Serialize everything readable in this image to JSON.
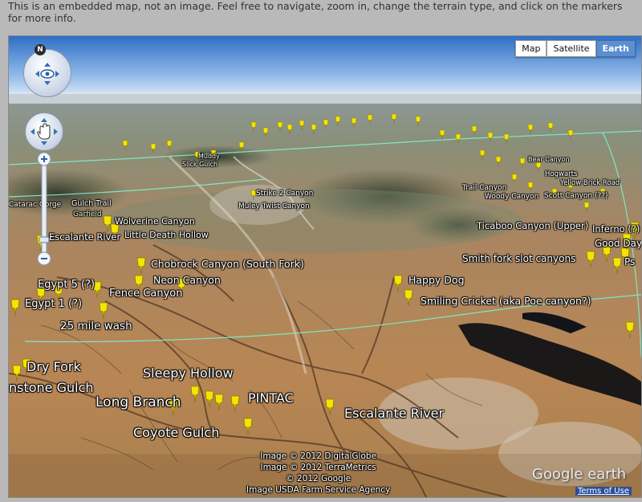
{
  "intro_text": "This is an embedded map, not an image. Feel free to navigate, zoom in, change the terrain type, and click on the markers for more info.",
  "view_buttons": [
    "Map",
    "Satellite",
    "Earth"
  ],
  "active_view": "Earth",
  "compass_letter": "N",
  "icons": {
    "look": "eye-icon",
    "pan": "hand-icon",
    "zoom_in": "plus-icon",
    "zoom_out": "minus-icon",
    "marker": "yellow-pushpin-icon"
  },
  "colors": {
    "marker": "#f5e400",
    "boundary_line": "#7fe7c4",
    "active_button": "#5b8fd0"
  },
  "labels": {
    "l01": "Catarac Gorge",
    "l02": "Gulch Trail",
    "l03": "Garfield",
    "l04": "Wolverine Canyon",
    "l05": "Escalante River",
    "l06": "Little Death Hollow",
    "l07": "Strike 2 Canyon",
    "l08": "Muley Twist Canyon",
    "l09": "Chobrock Canyon (South Fork)",
    "l10": "Neon Canyon",
    "l11": "Egypt 5 (?)",
    "l12": "Fence Canyon",
    "l13": "Egypt 1 (?)",
    "l14": "25 mile wash",
    "l15": "Dry Fork",
    "l16": "nstone Gulch",
    "l17": "Sleepy Hollow",
    "l18": "Long Branch",
    "l19": "PINTAC",
    "l20": "Escalante River",
    "l21": "Coyote Gulch",
    "l22": "Happy Dog",
    "l23": "Smiling Cricket (aka Poe canyon?)",
    "l24": "Ticaboo Canyon (Upper)",
    "l25": "Inferno (?)",
    "l26": "Good Day",
    "l27": "Smith fork slot canyons",
    "l28": "Ps",
    "l29": "Trail Canyon",
    "l30": "Woody Canyon",
    "l31": "Scott Canyon (??)",
    "l32": "Yellow Brick Road",
    "l33": "Hogwarts",
    "l34": "Bear Canyon",
    "l35": "Slick Gulch",
    "l36": "Muddy"
  },
  "credits": [
    "Image © 2012 DigitalGlobe",
    "Image © 2012 TerraMetrics",
    "© 2012 Google",
    "Image USDA Farm Service Agency"
  ],
  "logo_text": "Google earth",
  "terms_link": "Terms of Use"
}
